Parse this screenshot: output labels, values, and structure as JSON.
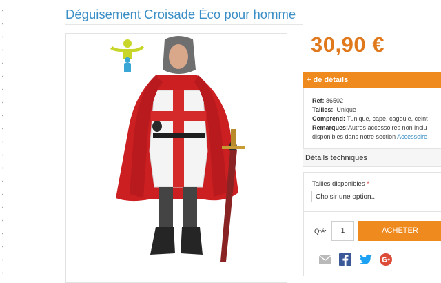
{
  "product": {
    "title": "Déguisement Croisade Éco pour homme",
    "price": "30,90 €",
    "image_alt": "Homme en déguisement de croisé avec cape rouge et épée",
    "age_badge_icon": "adult-age-icon"
  },
  "details": {
    "toggle_label": "+ de détails",
    "ref_label": "Ref:",
    "ref_value": "86502",
    "sizes_label": "Tailles:",
    "sizes_value": "Unique",
    "includes_label": "Comprend:",
    "includes_value": "Tunique, cape, cagoule, ceint",
    "remarks_label": "Remarques:",
    "remarks_value": "Autres accessoires non inclu",
    "remarks_cont": "disponibles dans notre section",
    "remarks_link": "Accessoire"
  },
  "tech_tab": "Détails techniques",
  "options": {
    "sizes_label": "Tailles disponibles",
    "required_mark": "*",
    "select_value": "Choisir une option..."
  },
  "buy": {
    "qty_label": "Qté:",
    "qty_value": "1",
    "button_label": "ACHETER"
  },
  "share": {
    "icons": [
      "email-icon",
      "facebook-icon",
      "twitter-icon",
      "google-plus-icon"
    ]
  },
  "colors": {
    "accent": "#ef8a1e",
    "price": "#e0781c",
    "title": "#3b8fc6"
  }
}
